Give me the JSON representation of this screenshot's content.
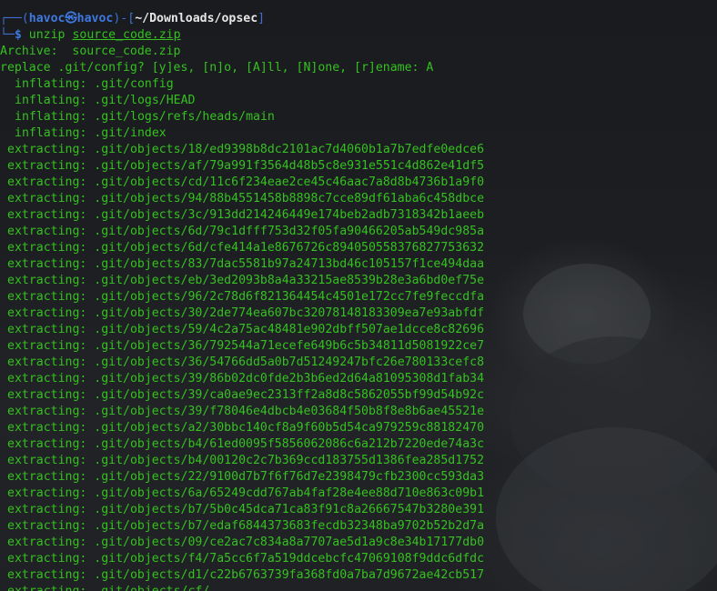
{
  "prompt": {
    "frame_open": "┌──(",
    "user": "havoc",
    "at_icon": "㉿",
    "host": "havoc",
    "frame_mid": ")-[",
    "path": "~/Downloads/opsec",
    "frame_close": "]",
    "frame_bottom": "└─",
    "symbol": "$",
    "command": "unzip",
    "argument": "source_code.zip"
  },
  "output": {
    "archive_line": "Archive:  source_code.zip",
    "replace_prompt": "replace .git/config? [y]es, [n]o, [A]ll, [N]one, [r]ename: A",
    "inflating": [
      "inflating: .git/config",
      "inflating: .git/logs/HEAD",
      "inflating: .git/logs/refs/heads/main",
      "inflating: .git/index"
    ],
    "extracting": [
      "extracting: .git/objects/18/ed9398b8dc2101ac7d4060b1a7b7edfe0edce6",
      "extracting: .git/objects/af/79a991f3564d48b5c8e931e551c4d862e41df5",
      "extracting: .git/objects/cd/11c6f234eae2ce45c46aac7a8d8b4736b1a9f0",
      "extracting: .git/objects/94/88b4551458b8898c7cce89df61aba6c458dbce",
      "extracting: .git/objects/3c/913dd214246449e174beb2adb7318342b1aeeb",
      "extracting: .git/objects/6d/79c1dfff753d32f05fa90466205ab549dc985a",
      "extracting: .git/objects/6d/cfe414a1e8676726c894050558376827753632",
      "extracting: .git/objects/83/7dac5581b97a24713bd46c105157f1ce494daa",
      "extracting: .git/objects/eb/3ed2093b8a4a33215ae8539b28e3a6bd0ef75e",
      "extracting: .git/objects/96/2c78d6f821364454c4501e172cc7fe9feccdfa",
      "extracting: .git/objects/30/2de774ea607bc32078148183309ea7e93abfdf",
      "extracting: .git/objects/59/4c2a75ac48481e902dbff507ae1dcce8c82696",
      "extracting: .git/objects/36/792544a71ecefe649b6c5b34811d5081922ce7",
      "extracting: .git/objects/36/54766dd5a0b7d51249247bfc26e780133cefc8",
      "extracting: .git/objects/39/86b02dc0fde2b3b6ed2d64a81095308d1fab34",
      "extracting: .git/objects/39/ca0ae9ec2313ff2a8d8c5862055bf99d54b92c",
      "extracting: .git/objects/39/f78046e4dbcb4e03684f50b8f8e8b6ae45521e",
      "extracting: .git/objects/a2/30bbc140cf8a9f60b5d54ca979259c88182470",
      "extracting: .git/objects/b4/61ed0095f5856062086c6a212b7220ede74a3c",
      "extracting: .git/objects/b4/00120c2c7b369ccd183755d1386fea285d1752",
      "extracting: .git/objects/22/9100d7b7f6f76d7e2398479cfb2300cc593da3",
      "extracting: .git/objects/6a/65249cdd767ab4faf28e4ee88d710e863c09b1",
      "extracting: .git/objects/b7/5b0c45dca71ca83f91c8a26667547b3280e391",
      "extracting: .git/objects/b7/edaf6844373683fecdb32348ba9702b52b2d7a",
      "extracting: .git/objects/09/ce2ac7c834a8a7707ae5d1a9c8e34b17177db0",
      "extracting: .git/objects/f4/7a5cc6f7a519ddcebcfc47069108f9ddc6dfdc",
      "extracting: .git/objects/d1/c22b6763739fa368fd0a7ba7d9672ae42cb517",
      "extracting: .git/objects/cf/"
    ]
  }
}
